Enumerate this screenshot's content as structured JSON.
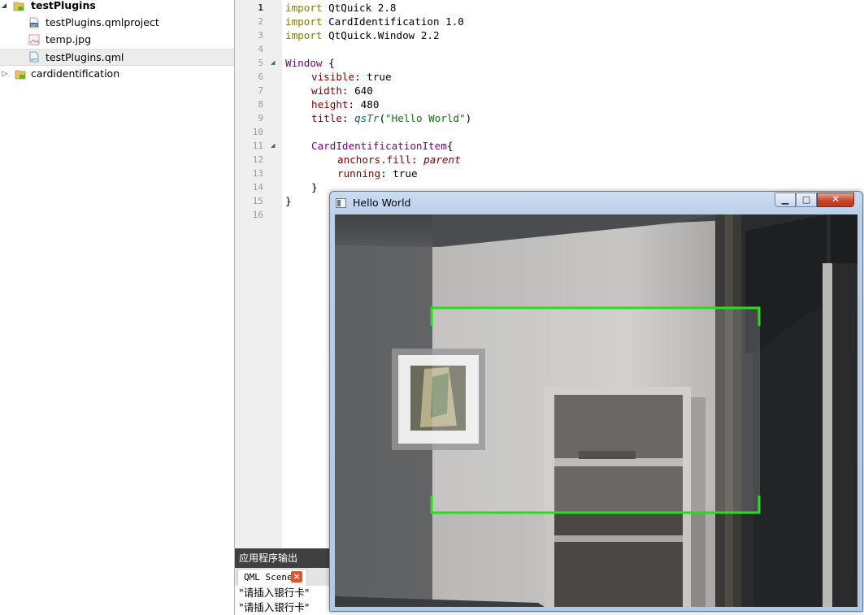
{
  "project_tree": {
    "items": [
      {
        "label": "testPlugins",
        "icon": "qml-project-folder-icon",
        "expanded": true
      },
      {
        "label": "testPlugins.qmlproject",
        "icon": "qmlproject-file-icon"
      },
      {
        "label": "temp.jpg",
        "icon": "image-file-icon"
      },
      {
        "label": "testPlugins.qml",
        "icon": "qml-file-icon",
        "selected": true
      },
      {
        "label": "cardidentification",
        "icon": "qt-project-folder-icon",
        "expanded": false
      }
    ]
  },
  "editor": {
    "line_numbers": [
      "1",
      "2",
      "3",
      "4",
      "5",
      "6",
      "7",
      "8",
      "9",
      "10",
      "11",
      "12",
      "13",
      "14",
      "15",
      "16"
    ],
    "current_line": 1,
    "code": {
      "l1_kw": "import",
      "l1_rest": " QtQuick 2.8",
      "l2_kw": "import",
      "l2_rest": " CardIdentification 1.0",
      "l3_kw": "import",
      "l3_rest": " QtQuick.Window 2.2",
      "l5_type": "Window",
      "l5_rest": " {",
      "l6_prop": "visible",
      "l6_rest": ": true",
      "l7_prop": "width",
      "l7_rest": ": 640",
      "l8_prop": "height",
      "l8_rest": ": 480",
      "l9_prop": "title",
      "l9_colon": ": ",
      "l9_func": "qsTr",
      "l9_open": "(",
      "l9_str": "\"Hello World\"",
      "l9_close": ")",
      "l11_type": "CardIdentificationItem",
      "l11_rest": "{",
      "l12_prop": "anchors.fill",
      "l12_colon": ": ",
      "l12_val": "parent",
      "l13_prop": "running",
      "l13_rest": ": true",
      "l14": "}",
      "l15": "}"
    }
  },
  "output_pane": {
    "header": "应用程序输出",
    "tab_label": "QML Scene",
    "lines": [
      "\"请插入银行卡\"",
      "\"请插入银行卡\""
    ]
  },
  "app_window": {
    "title": "Hello World",
    "guide_frame_color": "#22e01e"
  }
}
